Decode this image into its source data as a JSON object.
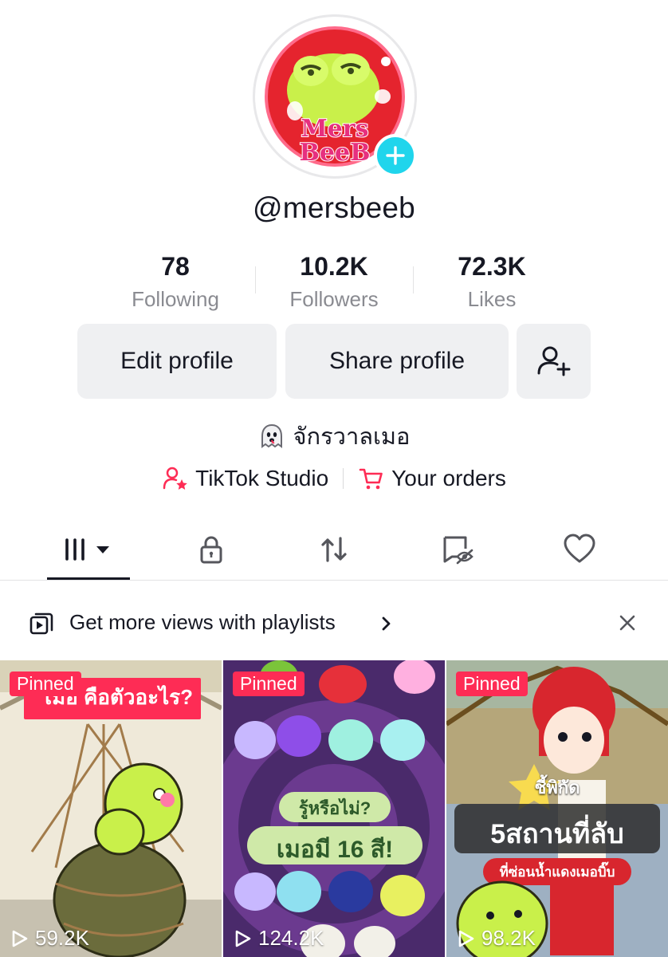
{
  "profile": {
    "username": "@mersbeeb",
    "avatar_text_line1": "Mers",
    "avatar_text_line2": "BeeB",
    "bio": "จักรวาลเมอ"
  },
  "stats": [
    {
      "value": "78",
      "label": "Following"
    },
    {
      "value": "10.2K",
      "label": "Followers"
    },
    {
      "value": "72.3K",
      "label": "Likes"
    }
  ],
  "buttons": {
    "edit": "Edit profile",
    "share": "Share profile"
  },
  "links": {
    "studio": "TikTok Studio",
    "orders": "Your orders"
  },
  "tabs": {
    "icons": [
      "grid-icon",
      "lock-icon",
      "repost-icon",
      "hidden-icon",
      "heart-icon"
    ],
    "active": 0
  },
  "playlist_banner": {
    "text": "Get more views with playlists"
  },
  "videos": [
    {
      "badge": "Pinned",
      "views": "59.2K",
      "caption": "เมอ คือตัวอะไร?"
    },
    {
      "badge": "Pinned",
      "views": "124.2K",
      "caption_line1": "รู้หรือไม่?",
      "caption_line2": "เมอมี 16 สี!"
    },
    {
      "badge": "Pinned",
      "views": "98.2K",
      "caption_line1": "ชี้พิกัด",
      "caption_line2": "5สถานที่ลับ",
      "caption_line3": "ที่ซ่อนน้ำแดงเมอบิ๊บ"
    }
  ],
  "colors": {
    "accent_red": "#fe2c55",
    "plus_cyan": "#20d5ec",
    "button_bg": "#eff0f2",
    "muted_text": "#8a8b91"
  }
}
